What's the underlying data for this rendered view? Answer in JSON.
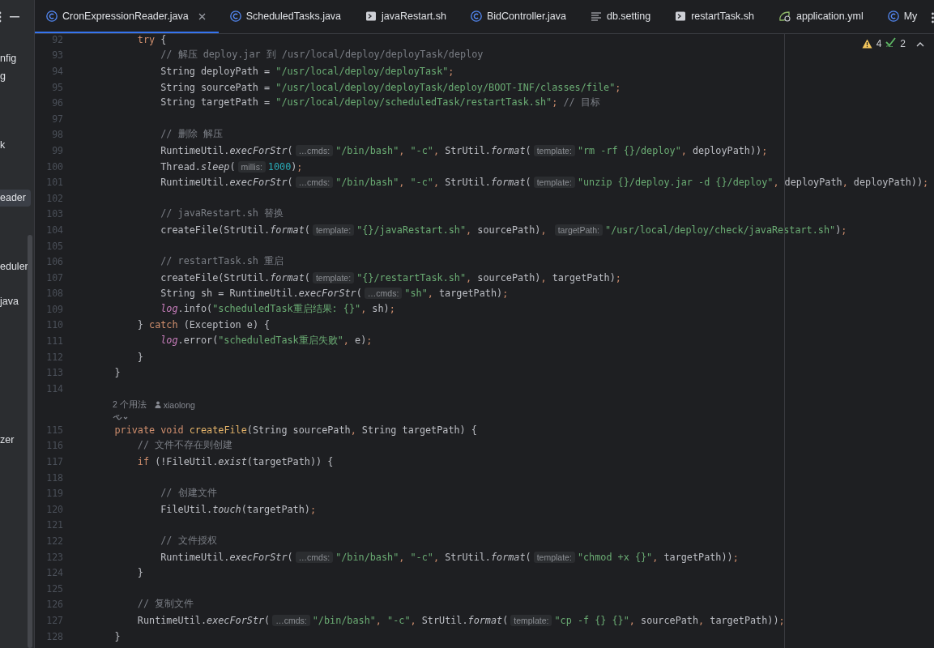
{
  "project_panel": {
    "items": [
      {
        "text": "nfig",
        "selected": false
      },
      {
        "text": "g",
        "selected": false
      },
      {
        "text": "k",
        "selected": false
      },
      {
        "text": "eader",
        "selected": true
      },
      {
        "text": "eduler",
        "selected": false
      },
      {
        "text": "java",
        "selected": false
      },
      {
        "text": "zer",
        "selected": false
      }
    ]
  },
  "tabs": [
    {
      "label": "CronExpressionReader.java",
      "kind": "java",
      "selected": true,
      "closable": true
    },
    {
      "label": "ScheduledTasks.java",
      "kind": "java",
      "selected": false,
      "closable": false
    },
    {
      "label": "javaRestart.sh",
      "kind": "shell",
      "selected": false,
      "closable": false
    },
    {
      "label": "BidController.java",
      "kind": "java",
      "selected": false,
      "closable": false
    },
    {
      "label": "db.setting",
      "kind": "text",
      "selected": false,
      "closable": false
    },
    {
      "label": "restartTask.sh",
      "kind": "shell",
      "selected": false,
      "closable": false
    },
    {
      "label": "application.yml",
      "kind": "yaml",
      "selected": false,
      "closable": false
    },
    {
      "label": "My",
      "kind": "java",
      "selected": false,
      "closable": false
    }
  ],
  "inspections": {
    "warnings": "4",
    "weak_warnings": "2"
  },
  "code_lines": [
    {
      "kind": "code",
      "number": "92",
      "segments": [
        {
          "kind": "code",
          "tokens": [
            {
              "kind": "keyword",
              "text": "        try"
            },
            {
              "kind": "plain",
              "text": " {"
            }
          ]
        }
      ]
    },
    {
      "kind": "code",
      "number": "93",
      "segments": [
        {
          "kind": "code",
          "tokens": [
            {
              "kind": "comment",
              "text": "            // 解压 deploy.jar 到 /usr/local/deploy/deployTask/deploy"
            }
          ]
        }
      ]
    },
    {
      "kind": "code",
      "number": "94",
      "segments": [
        {
          "kind": "code",
          "tokens": [
            {
              "kind": "plain",
              "text": "            String deployPath = "
            },
            {
              "kind": "string",
              "text": "\"/usr/local/deploy/deployTask\""
            },
            {
              "kind": "punct",
              "text": ";"
            }
          ]
        }
      ]
    },
    {
      "kind": "code",
      "number": "95",
      "segments": [
        {
          "kind": "code",
          "tokens": [
            {
              "kind": "plain",
              "text": "            String sourcePath = "
            },
            {
              "kind": "string",
              "text": "\"/usr/local/deploy/deployTask/deploy/BOOT-INF/classes/file\""
            },
            {
              "kind": "punct",
              "text": ";"
            }
          ]
        }
      ]
    },
    {
      "kind": "code",
      "number": "96",
      "segments": [
        {
          "kind": "code",
          "tokens": [
            {
              "kind": "plain",
              "text": "            String targetPath = "
            },
            {
              "kind": "string",
              "text": "\"/usr/local/deploy/scheduledTask/restartTask.sh\""
            },
            {
              "kind": "punct",
              "text": ";"
            },
            {
              "kind": "comment",
              "text": " // 目标"
            }
          ]
        }
      ]
    },
    {
      "kind": "code",
      "number": "97"
    },
    {
      "kind": "code",
      "number": "98",
      "segments": [
        {
          "kind": "code",
          "tokens": [
            {
              "kind": "comment",
              "text": "            // 删除 解压"
            }
          ]
        }
      ]
    },
    {
      "kind": "code",
      "number": "99",
      "segments": [
        {
          "kind": "code",
          "tokens": [
            {
              "kind": "plain",
              "text": "            RuntimeUtil."
            },
            {
              "kind": "method",
              "text": "execForStr"
            },
            {
              "kind": "plain",
              "text": "("
            }
          ]
        },
        {
          "kind": "hint",
          "text": "…cmds:"
        },
        {
          "kind": "code",
          "tokens": [
            {
              "kind": "string",
              "text": "\"/bin/bash\""
            },
            {
              "kind": "punct",
              "text": ", "
            },
            {
              "kind": "string",
              "text": "\"-c\""
            },
            {
              "kind": "punct",
              "text": ", "
            },
            {
              "kind": "plain",
              "text": "StrUtil."
            },
            {
              "kind": "method",
              "text": "format"
            },
            {
              "kind": "plain",
              "text": "("
            }
          ]
        },
        {
          "kind": "hint",
          "text": "template:"
        },
        {
          "kind": "code",
          "tokens": [
            {
              "kind": "string",
              "text": "\"rm -rf {}/deploy\""
            },
            {
              "kind": "punct",
              "text": ", "
            },
            {
              "kind": "plain",
              "text": "deployPath))"
            },
            {
              "kind": "punct",
              "text": ";"
            }
          ]
        }
      ]
    },
    {
      "kind": "code",
      "number": "100",
      "segments": [
        {
          "kind": "code",
          "tokens": [
            {
              "kind": "plain",
              "text": "            Thread."
            },
            {
              "kind": "method",
              "text": "sleep"
            },
            {
              "kind": "plain",
              "text": "("
            }
          ]
        },
        {
          "kind": "hint",
          "text": "millis:"
        },
        {
          "kind": "code",
          "tokens": [
            {
              "kind": "number",
              "text": "1000"
            },
            {
              "kind": "plain",
              "text": ")"
            },
            {
              "kind": "punct",
              "text": ";"
            }
          ]
        }
      ]
    },
    {
      "kind": "code",
      "number": "101",
      "segments": [
        {
          "kind": "code",
          "tokens": [
            {
              "kind": "plain",
              "text": "            RuntimeUtil."
            },
            {
              "kind": "method",
              "text": "execForStr"
            },
            {
              "kind": "plain",
              "text": "("
            }
          ]
        },
        {
          "kind": "hint",
          "text": "…cmds:"
        },
        {
          "kind": "code",
          "tokens": [
            {
              "kind": "string",
              "text": "\"/bin/bash\""
            },
            {
              "kind": "punct",
              "text": ", "
            },
            {
              "kind": "string",
              "text": "\"-c\""
            },
            {
              "kind": "punct",
              "text": ", "
            },
            {
              "kind": "plain",
              "text": "StrUtil."
            },
            {
              "kind": "method",
              "text": "format"
            },
            {
              "kind": "plain",
              "text": "("
            }
          ]
        },
        {
          "kind": "hint",
          "text": "template:"
        },
        {
          "kind": "code",
          "tokens": [
            {
              "kind": "string",
              "text": "\"unzip {}/deploy.jar -d {}/deploy\""
            },
            {
              "kind": "punct",
              "text": ", "
            },
            {
              "kind": "plain",
              "text": "deployPath"
            },
            {
              "kind": "punct",
              "text": ", "
            },
            {
              "kind": "plain",
              "text": "deployPath))"
            },
            {
              "kind": "punct",
              "text": ";"
            }
          ]
        }
      ]
    },
    {
      "kind": "code",
      "number": "102"
    },
    {
      "kind": "code",
      "number": "103",
      "segments": [
        {
          "kind": "code",
          "tokens": [
            {
              "kind": "comment",
              "text": "            // javaRestart.sh 替换"
            }
          ]
        }
      ]
    },
    {
      "kind": "code",
      "number": "104",
      "segments": [
        {
          "kind": "code",
          "tokens": [
            {
              "kind": "plain",
              "text": "            createFile(StrUtil."
            },
            {
              "kind": "method",
              "text": "format"
            },
            {
              "kind": "plain",
              "text": "("
            }
          ]
        },
        {
          "kind": "hint",
          "text": "template:"
        },
        {
          "kind": "code",
          "tokens": [
            {
              "kind": "string",
              "text": "\"{}/javaRestart.sh\""
            },
            {
              "kind": "punct",
              "text": ", "
            },
            {
              "kind": "plain",
              "text": "sourcePath)"
            },
            {
              "kind": "punct",
              "text": ", "
            }
          ]
        },
        {
          "kind": "hint",
          "text": "targetPath:"
        },
        {
          "kind": "code",
          "tokens": [
            {
              "kind": "string",
              "text": "\"/usr/local/deploy/check/javaRestart.sh\""
            },
            {
              "kind": "plain",
              "text": ")"
            },
            {
              "kind": "punct",
              "text": ";"
            }
          ]
        }
      ]
    },
    {
      "kind": "code",
      "number": "105"
    },
    {
      "kind": "code",
      "number": "106",
      "segments": [
        {
          "kind": "code",
          "tokens": [
            {
              "kind": "comment",
              "text": "            // restartTask.sh 重启"
            }
          ]
        }
      ]
    },
    {
      "kind": "code",
      "number": "107",
      "segments": [
        {
          "kind": "code",
          "tokens": [
            {
              "kind": "plain",
              "text": "            createFile(StrUtil."
            },
            {
              "kind": "method",
              "text": "format"
            },
            {
              "kind": "plain",
              "text": "("
            }
          ]
        },
        {
          "kind": "hint",
          "text": "template:"
        },
        {
          "kind": "code",
          "tokens": [
            {
              "kind": "string",
              "text": "\"{}/restartTask.sh\""
            },
            {
              "kind": "punct",
              "text": ", "
            },
            {
              "kind": "plain",
              "text": "sourcePath)"
            },
            {
              "kind": "punct",
              "text": ", "
            },
            {
              "kind": "plain",
              "text": "targetPath)"
            },
            {
              "kind": "punct",
              "text": ";"
            }
          ]
        }
      ]
    },
    {
      "kind": "code",
      "number": "108",
      "segments": [
        {
          "kind": "code",
          "tokens": [
            {
              "kind": "plain",
              "text": "            String sh = RuntimeUtil."
            },
            {
              "kind": "method",
              "text": "execForStr"
            },
            {
              "kind": "plain",
              "text": "("
            }
          ]
        },
        {
          "kind": "hint",
          "text": "…cmds:"
        },
        {
          "kind": "code",
          "tokens": [
            {
              "kind": "string",
              "text": "\"sh\""
            },
            {
              "kind": "punct",
              "text": ", "
            },
            {
              "kind": "plain",
              "text": "targetPath)"
            },
            {
              "kind": "punct",
              "text": ";"
            }
          ]
        }
      ]
    },
    {
      "kind": "code",
      "number": "109",
      "segments": [
        {
          "kind": "code",
          "tokens": [
            {
              "kind": "field",
              "text": "            log"
            },
            {
              "kind": "plain",
              "text": ".info("
            },
            {
              "kind": "string",
              "text": "\"scheduledTask重启结果: {}\""
            },
            {
              "kind": "punct",
              "text": ", "
            },
            {
              "kind": "plain",
              "text": "sh)"
            },
            {
              "kind": "punct",
              "text": ";"
            }
          ]
        }
      ]
    },
    {
      "kind": "code",
      "number": "110",
      "segments": [
        {
          "kind": "code",
          "tokens": [
            {
              "kind": "plain",
              "text": "        } "
            },
            {
              "kind": "keyword",
              "text": "catch"
            },
            {
              "kind": "plain",
              "text": " (Exception e) {"
            }
          ]
        }
      ]
    },
    {
      "kind": "code",
      "number": "111",
      "segments": [
        {
          "kind": "code",
          "tokens": [
            {
              "kind": "field",
              "text": "            log"
            },
            {
              "kind": "plain",
              "text": ".error("
            },
            {
              "kind": "string",
              "text": "\"scheduledTask重启失败\""
            },
            {
              "kind": "punct",
              "text": ", "
            },
            {
              "kind": "plain",
              "text": "e)"
            },
            {
              "kind": "punct",
              "text": ";"
            }
          ]
        }
      ]
    },
    {
      "kind": "code",
      "number": "112",
      "segments": [
        {
          "kind": "code",
          "tokens": [
            {
              "kind": "plain",
              "text": "        }"
            }
          ]
        }
      ]
    },
    {
      "kind": "code",
      "number": "113",
      "segments": [
        {
          "kind": "code",
          "tokens": [
            {
              "kind": "plain",
              "text": "    }"
            }
          ]
        }
      ]
    },
    {
      "kind": "code",
      "number": "114"
    },
    {
      "kind": "lens",
      "usages": "2 个用法",
      "author": "xiaolong"
    },
    {
      "kind": "assist"
    },
    {
      "kind": "code",
      "number": "115",
      "segments": [
        {
          "kind": "code",
          "tokens": [
            {
              "kind": "keyword",
              "text": "    private void "
            },
            {
              "kind": "declaration",
              "text": "createFile"
            },
            {
              "kind": "plain",
              "text": "(String sourcePath"
            },
            {
              "kind": "punct",
              "text": ", "
            },
            {
              "kind": "plain",
              "text": "String targetPath) {"
            }
          ]
        }
      ]
    },
    {
      "kind": "code",
      "number": "116",
      "segments": [
        {
          "kind": "code",
          "tokens": [
            {
              "kind": "comment",
              "text": "        // 文件不存在则创建"
            }
          ]
        }
      ]
    },
    {
      "kind": "code",
      "number": "117",
      "segments": [
        {
          "kind": "code",
          "tokens": [
            {
              "kind": "keyword",
              "text": "        if"
            },
            {
              "kind": "plain",
              "text": " (!FileUtil."
            },
            {
              "kind": "method",
              "text": "exist"
            },
            {
              "kind": "plain",
              "text": "(targetPath)) {"
            }
          ]
        }
      ]
    },
    {
      "kind": "code",
      "number": "118"
    },
    {
      "kind": "code",
      "number": "119",
      "segments": [
        {
          "kind": "code",
          "tokens": [
            {
              "kind": "comment",
              "text": "            // 创建文件"
            }
          ]
        }
      ]
    },
    {
      "kind": "code",
      "number": "120",
      "segments": [
        {
          "kind": "code",
          "tokens": [
            {
              "kind": "plain",
              "text": "            FileUtil."
            },
            {
              "kind": "method",
              "text": "touch"
            },
            {
              "kind": "plain",
              "text": "(targetPath)"
            },
            {
              "kind": "punct",
              "text": ";"
            }
          ]
        }
      ]
    },
    {
      "kind": "code",
      "number": "121"
    },
    {
      "kind": "code",
      "number": "122",
      "segments": [
        {
          "kind": "code",
          "tokens": [
            {
              "kind": "comment",
              "text": "            // 文件授权"
            }
          ]
        }
      ]
    },
    {
      "kind": "code",
      "number": "123",
      "segments": [
        {
          "kind": "code",
          "tokens": [
            {
              "kind": "plain",
              "text": "            RuntimeUtil."
            },
            {
              "kind": "method",
              "text": "execForStr"
            },
            {
              "kind": "plain",
              "text": "("
            }
          ]
        },
        {
          "kind": "hint",
          "text": "…cmds:"
        },
        {
          "kind": "code",
          "tokens": [
            {
              "kind": "string",
              "text": "\"/bin/bash\""
            },
            {
              "kind": "punct",
              "text": ", "
            },
            {
              "kind": "string",
              "text": "\"-c\""
            },
            {
              "kind": "punct",
              "text": ", "
            },
            {
              "kind": "plain",
              "text": "StrUtil."
            },
            {
              "kind": "method",
              "text": "format"
            },
            {
              "kind": "plain",
              "text": "("
            }
          ]
        },
        {
          "kind": "hint",
          "text": "template:"
        },
        {
          "kind": "code",
          "tokens": [
            {
              "kind": "string",
              "text": "\"chmod +x {}\""
            },
            {
              "kind": "punct",
              "text": ", "
            },
            {
              "kind": "plain",
              "text": "targetPath))"
            },
            {
              "kind": "punct",
              "text": ";"
            }
          ]
        }
      ]
    },
    {
      "kind": "code",
      "number": "124",
      "segments": [
        {
          "kind": "code",
          "tokens": [
            {
              "kind": "plain",
              "text": "        }"
            }
          ]
        }
      ]
    },
    {
      "kind": "code",
      "number": "125"
    },
    {
      "kind": "code",
      "number": "126",
      "segments": [
        {
          "kind": "code",
          "tokens": [
            {
              "kind": "comment",
              "text": "        // 复制文件"
            }
          ]
        }
      ]
    },
    {
      "kind": "code",
      "number": "127",
      "segments": [
        {
          "kind": "code",
          "tokens": [
            {
              "kind": "plain",
              "text": "        RuntimeUtil."
            },
            {
              "kind": "method",
              "text": "execForStr"
            },
            {
              "kind": "plain",
              "text": "("
            }
          ]
        },
        {
          "kind": "hint",
          "text": "…cmds:"
        },
        {
          "kind": "code",
          "tokens": [
            {
              "kind": "string",
              "text": "\"/bin/bash\""
            },
            {
              "kind": "punct",
              "text": ", "
            },
            {
              "kind": "string",
              "text": "\"-c\""
            },
            {
              "kind": "punct",
              "text": ", "
            },
            {
              "kind": "plain",
              "text": "StrUtil."
            },
            {
              "kind": "method",
              "text": "format"
            },
            {
              "kind": "plain",
              "text": "("
            }
          ]
        },
        {
          "kind": "hint",
          "text": "template:"
        },
        {
          "kind": "code",
          "tokens": [
            {
              "kind": "string",
              "text": "\"cp -f {} {}\""
            },
            {
              "kind": "punct",
              "text": ", "
            },
            {
              "kind": "plain",
              "text": "sourcePath"
            },
            {
              "kind": "punct",
              "text": ", "
            },
            {
              "kind": "plain",
              "text": "targetPath))"
            },
            {
              "kind": "punct",
              "text": ";"
            }
          ]
        }
      ]
    },
    {
      "kind": "code",
      "number": "128",
      "segments": [
        {
          "kind": "code",
          "tokens": [
            {
              "kind": "plain",
              "text": "    }"
            }
          ]
        }
      ]
    }
  ]
}
